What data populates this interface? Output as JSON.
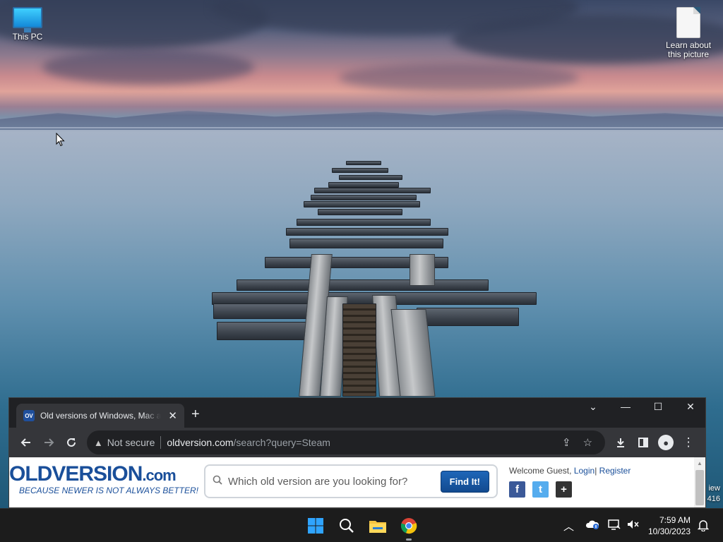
{
  "desktop": {
    "icons": [
      {
        "label": "This PC",
        "icon": "monitor-icon"
      },
      {
        "label": "Learn about this picture",
        "icon": "document-icon"
      }
    ],
    "edge_text": {
      "line1": "iew",
      "line2": "416"
    }
  },
  "browser": {
    "tab": {
      "title": "Old versions of Windows, Mac and Linux software",
      "favicon_text": "OV"
    },
    "window_controls": {
      "tab_search": "⌄",
      "minimize": "—",
      "maximize": "☐",
      "close": "✕"
    },
    "new_tab": "+",
    "address": {
      "security_label": "Not secure",
      "host": "oldversion.com",
      "path": "/search?query=Steam"
    }
  },
  "page": {
    "logo_main": "OLDVERSION",
    "logo_dotcom": ".com",
    "tagline": "BECAUSE NEWER IS NOT ALWAYS BETTER!",
    "search": {
      "placeholder": "Which old version are you looking for?",
      "button": "Find It!"
    },
    "account": {
      "welcome": "Welcome Guest,",
      "login": "Login",
      "divider": "|",
      "register": "Register"
    },
    "social": [
      {
        "name": "facebook-icon",
        "glyph": "f",
        "color": "#3b5998"
      },
      {
        "name": "twitter-icon",
        "glyph": "t",
        "color": "#55acee"
      },
      {
        "name": "add-icon",
        "glyph": "+",
        "color": "#333333"
      }
    ]
  },
  "taskbar": {
    "apps": [
      "start-icon",
      "search-icon",
      "file-explorer-icon",
      "chrome-icon"
    ],
    "clock": {
      "time": "7:59 AM",
      "date": "10/30/2023"
    }
  },
  "colors": {
    "brand": "#1a4f9a",
    "chrome_dark": "#202124",
    "chrome_toolbar": "#35363a"
  }
}
